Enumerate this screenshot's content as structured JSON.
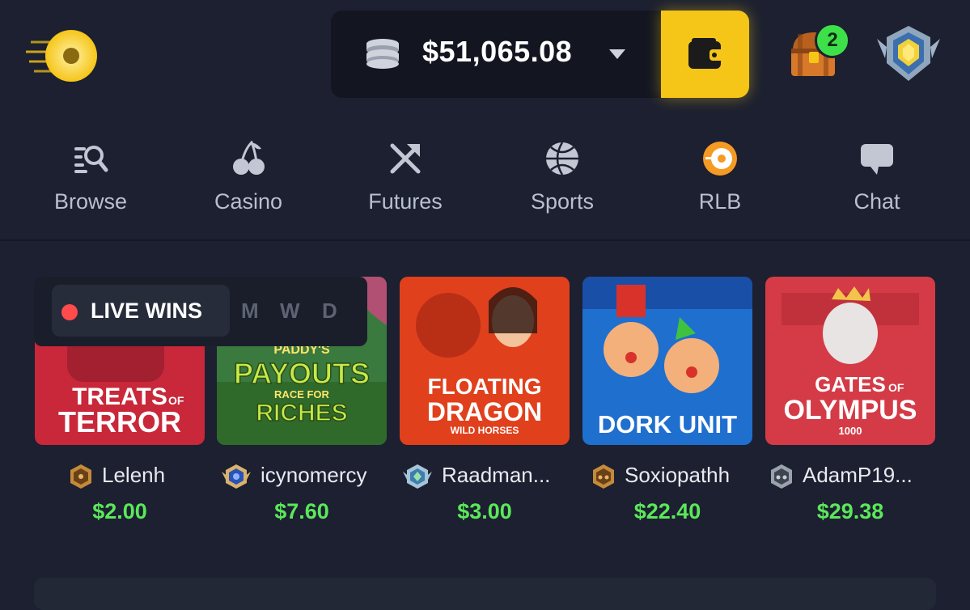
{
  "header": {
    "balance": "$51,065.08",
    "notification_count": "2"
  },
  "nav": [
    {
      "label": "Browse",
      "icon": "browse-search-icon"
    },
    {
      "label": "Casino",
      "icon": "cherries-icon"
    },
    {
      "label": "Futures",
      "icon": "crossed-arrows-icon"
    },
    {
      "label": "Sports",
      "icon": "basketball-icon"
    },
    {
      "label": "RLB",
      "icon": "rlb-coin-icon"
    },
    {
      "label": "Chat",
      "icon": "chat-bubble-icon"
    }
  ],
  "live_wins": {
    "label": "LIVE WINS",
    "tabs": [
      "M",
      "W",
      "D"
    ]
  },
  "games": [
    {
      "title_line1": "TREATS",
      "title_small": "OF",
      "title_line2": "TERROR",
      "player": "Lelenh",
      "amount": "$2.00"
    },
    {
      "title_line1": "PADDY'S",
      "title_line2": "PAYOUTS",
      "title_line3": "RACE FOR",
      "title_line4": "RICHES",
      "player": "icynomercy",
      "amount": "$7.60"
    },
    {
      "title_line1": "FLOATING",
      "title_line2": "DRAGON",
      "title_line3": "WILD HORSES",
      "player": "Raadman...",
      "amount": "$3.00"
    },
    {
      "title_line1": "DORK UNIT",
      "player": "Soxiopathh",
      "amount": "$22.40"
    },
    {
      "title_line1": "GATES",
      "title_small": "OF",
      "title_line2": "OLYMPUS",
      "title_line3": "1000",
      "player": "AdamP19...",
      "amount": "$29.38"
    }
  ],
  "colors": {
    "background": "#1c2030",
    "accent_yellow": "#f5c518",
    "win_green": "#5be85a",
    "live_red": "#ff4b4b"
  }
}
